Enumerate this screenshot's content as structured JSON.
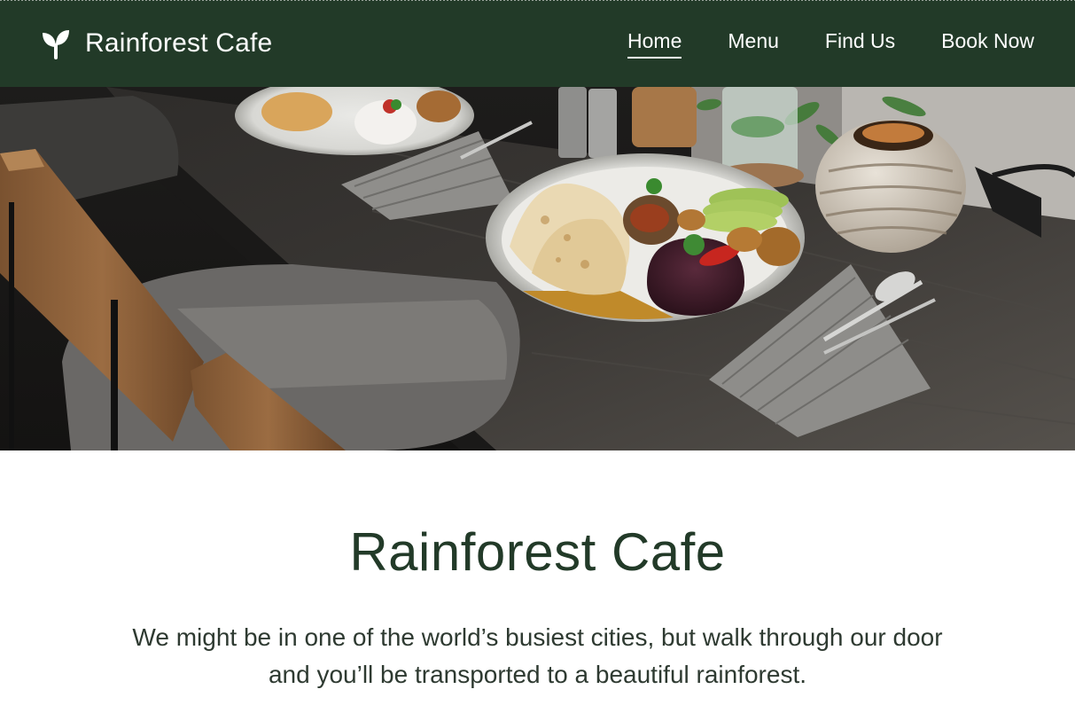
{
  "brand": {
    "name": "Rainforest Cafe",
    "logo_icon": "sprout-icon"
  },
  "nav": {
    "items": [
      {
        "label": "Home",
        "active": true
      },
      {
        "label": "Menu",
        "active": false
      },
      {
        "label": "Find Us",
        "active": false
      },
      {
        "label": "Book Now",
        "active": false
      }
    ]
  },
  "hero": {
    "image_subject": "plated meal on dark wooden cafe table"
  },
  "intro": {
    "title": "Rainforest Cafe",
    "tagline": "We might be in one of the world’s busiest cities, but walk through our door and you’ll be transported to a beautiful rainforest."
  },
  "colors": {
    "nav_background": "#223a28",
    "title_color": "#223a28",
    "text_color": "#2e3a31",
    "page_background": "#ffffff"
  }
}
